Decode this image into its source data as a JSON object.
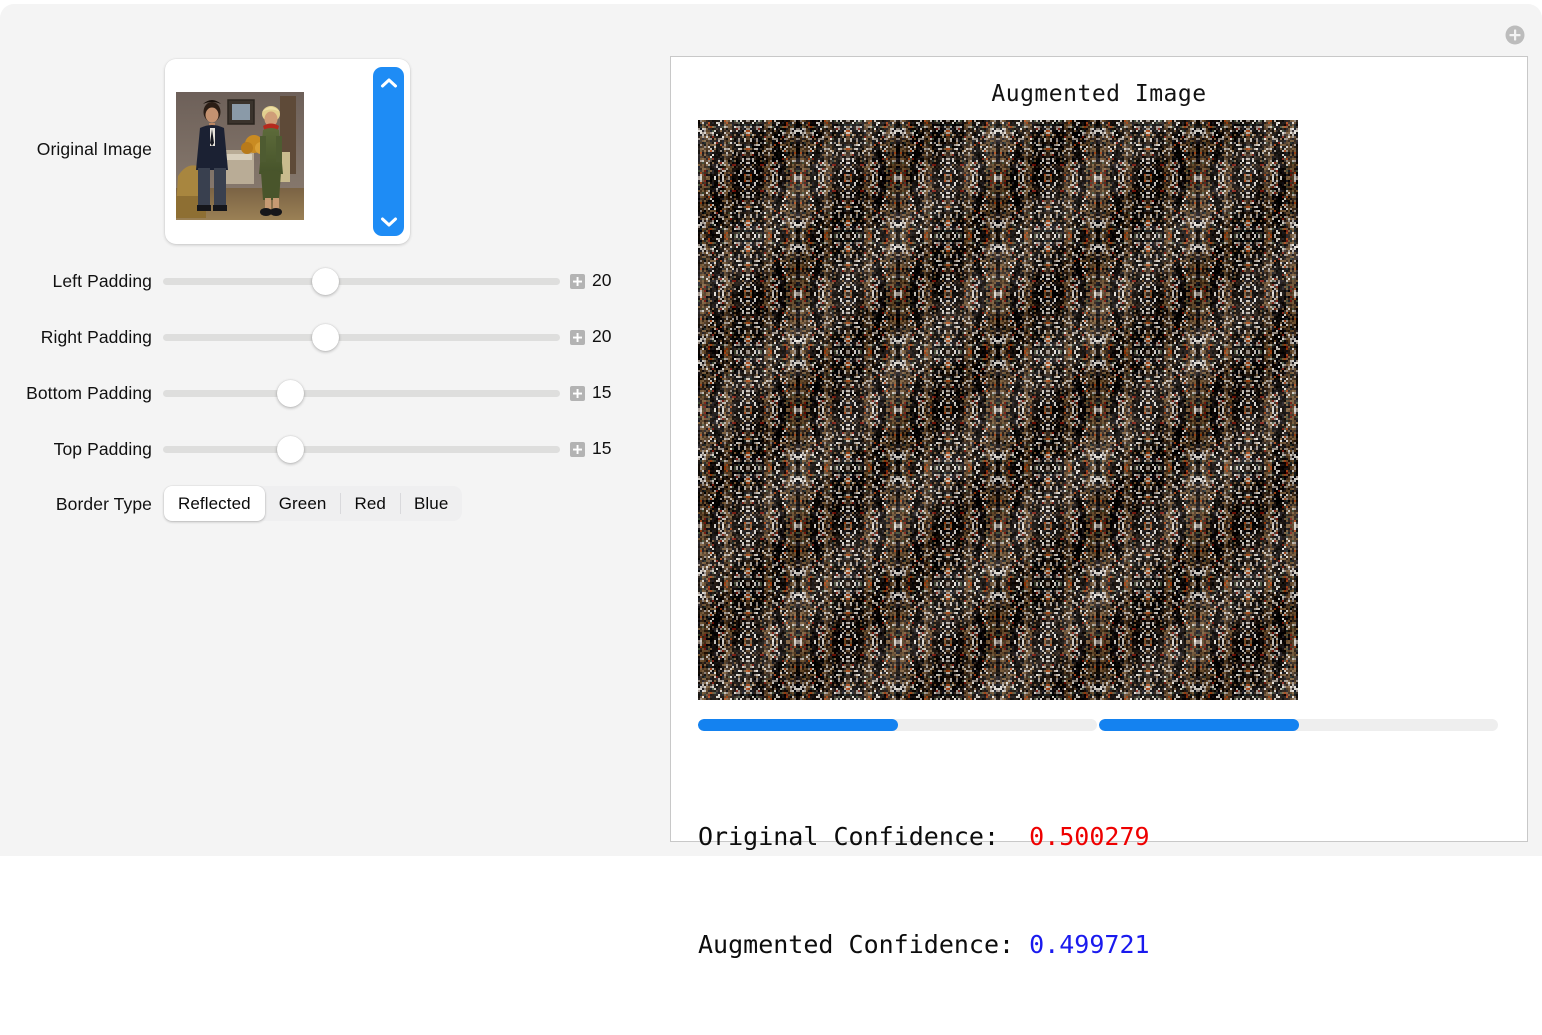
{
  "app": {
    "background_color": "#f4f4f4",
    "add_icon": "plus-circle-icon"
  },
  "controls": {
    "original_image": {
      "label": "Original Image",
      "scrollbar": {
        "up_icon": "chevron-up-icon",
        "down_icon": "chevron-down-icon",
        "color": "#1e8cf5"
      }
    },
    "sliders": [
      {
        "id": "left-padding",
        "label": "Left Padding",
        "value": "20",
        "percent": 41,
        "stepper_icon": "plus-square-icon"
      },
      {
        "id": "right-padding",
        "label": "Right Padding",
        "value": "20",
        "percent": 41,
        "stepper_icon": "plus-square-icon"
      },
      {
        "id": "bottom-padding",
        "label": "Bottom Padding",
        "value": "15",
        "percent": 32,
        "stepper_icon": "plus-square-icon"
      },
      {
        "id": "top-padding",
        "label": "Top Padding",
        "value": "15",
        "percent": 32,
        "stepper_icon": "plus-square-icon"
      }
    ],
    "border_type": {
      "label": "Border Type",
      "options": [
        "Reflected",
        "Green",
        "Red",
        "Blue"
      ],
      "selected": "Reflected"
    }
  },
  "output": {
    "title": "Augmented Image",
    "progress_bars": [
      {
        "name": "original-confidence-bar",
        "percent": 50
      },
      {
        "name": "augmented-confidence-bar",
        "percent": 50
      }
    ],
    "confidence": {
      "original_label": "Original Confidence:  ",
      "original_value": "0.500279",
      "original_color": "#ee0000",
      "augmented_label": "Augmented Confidence: ",
      "augmented_value": "0.499721",
      "augmented_color": "#1a1aee"
    }
  }
}
